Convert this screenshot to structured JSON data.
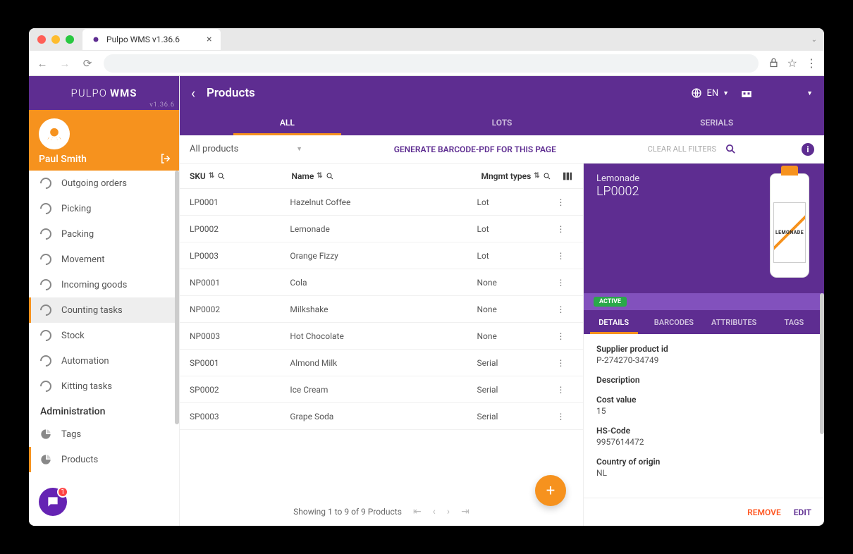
{
  "browser": {
    "tab_title": "Pulpo WMS v1.36.6"
  },
  "brand": {
    "name": "PULPO",
    "suffix": "WMS",
    "version": "v1.36.6"
  },
  "user": {
    "name": "Paul Smith"
  },
  "nav": {
    "items": [
      {
        "label": "Outgoing orders"
      },
      {
        "label": "Picking"
      },
      {
        "label": "Packing"
      },
      {
        "label": "Movement"
      },
      {
        "label": "Incoming goods"
      },
      {
        "label": "Counting tasks"
      },
      {
        "label": "Stock"
      },
      {
        "label": "Automation"
      },
      {
        "label": "Kitting tasks"
      }
    ],
    "admin_section": "Administration",
    "admin_items": [
      {
        "label": "Tags"
      },
      {
        "label": "Products"
      }
    ],
    "chat_badge": "1"
  },
  "header": {
    "title": "Products",
    "language": "EN",
    "tabs": [
      "ALL",
      "LOTS",
      "SERIALS"
    ]
  },
  "filter": {
    "select_label": "All products",
    "generate_barcode": "GENERATE BARCODE-PDF FOR THIS PAGE",
    "clear": "CLEAR ALL FILTERS"
  },
  "table": {
    "columns": {
      "sku": "SKU",
      "name": "Name",
      "mgmt": "Mngmt types"
    },
    "rows": [
      {
        "sku": "LP0001",
        "name": "Hazelnut Coffee",
        "mgmt": "Lot"
      },
      {
        "sku": "LP0002",
        "name": "Lemonade",
        "mgmt": "Lot"
      },
      {
        "sku": "LP0003",
        "name": "Orange Fizzy",
        "mgmt": "Lot"
      },
      {
        "sku": "NP0001",
        "name": "Cola",
        "mgmt": "None"
      },
      {
        "sku": "NP0002",
        "name": "Milkshake",
        "mgmt": "None"
      },
      {
        "sku": "NP0003",
        "name": "Hot Chocolate",
        "mgmt": "None"
      },
      {
        "sku": "SP0001",
        "name": "Almond Milk",
        "mgmt": "Serial"
      },
      {
        "sku": "SP0002",
        "name": "Ice Cream",
        "mgmt": "Serial"
      },
      {
        "sku": "SP0003",
        "name": "Grape Soda",
        "mgmt": "Serial"
      }
    ],
    "pagination": "Showing 1 to 9 of 9 Products"
  },
  "detail": {
    "name": "Lemonade",
    "sku": "LP0002",
    "bottle_label": "LEMONADE",
    "status": "ACTIVE",
    "tabs": [
      "DETAILS",
      "BARCODES",
      "ATTRIBUTES",
      "TAGS"
    ],
    "fields": {
      "supplier_label": "Supplier product id",
      "supplier_value": "P-274270-34749",
      "description_label": "Description",
      "description_value": "",
      "cost_label": "Cost value",
      "cost_value": "15",
      "hs_label": "HS-Code",
      "hs_value": "9957614472",
      "origin_label": "Country of origin",
      "origin_value": "NL"
    },
    "remove": "REMOVE",
    "edit": "EDIT"
  }
}
